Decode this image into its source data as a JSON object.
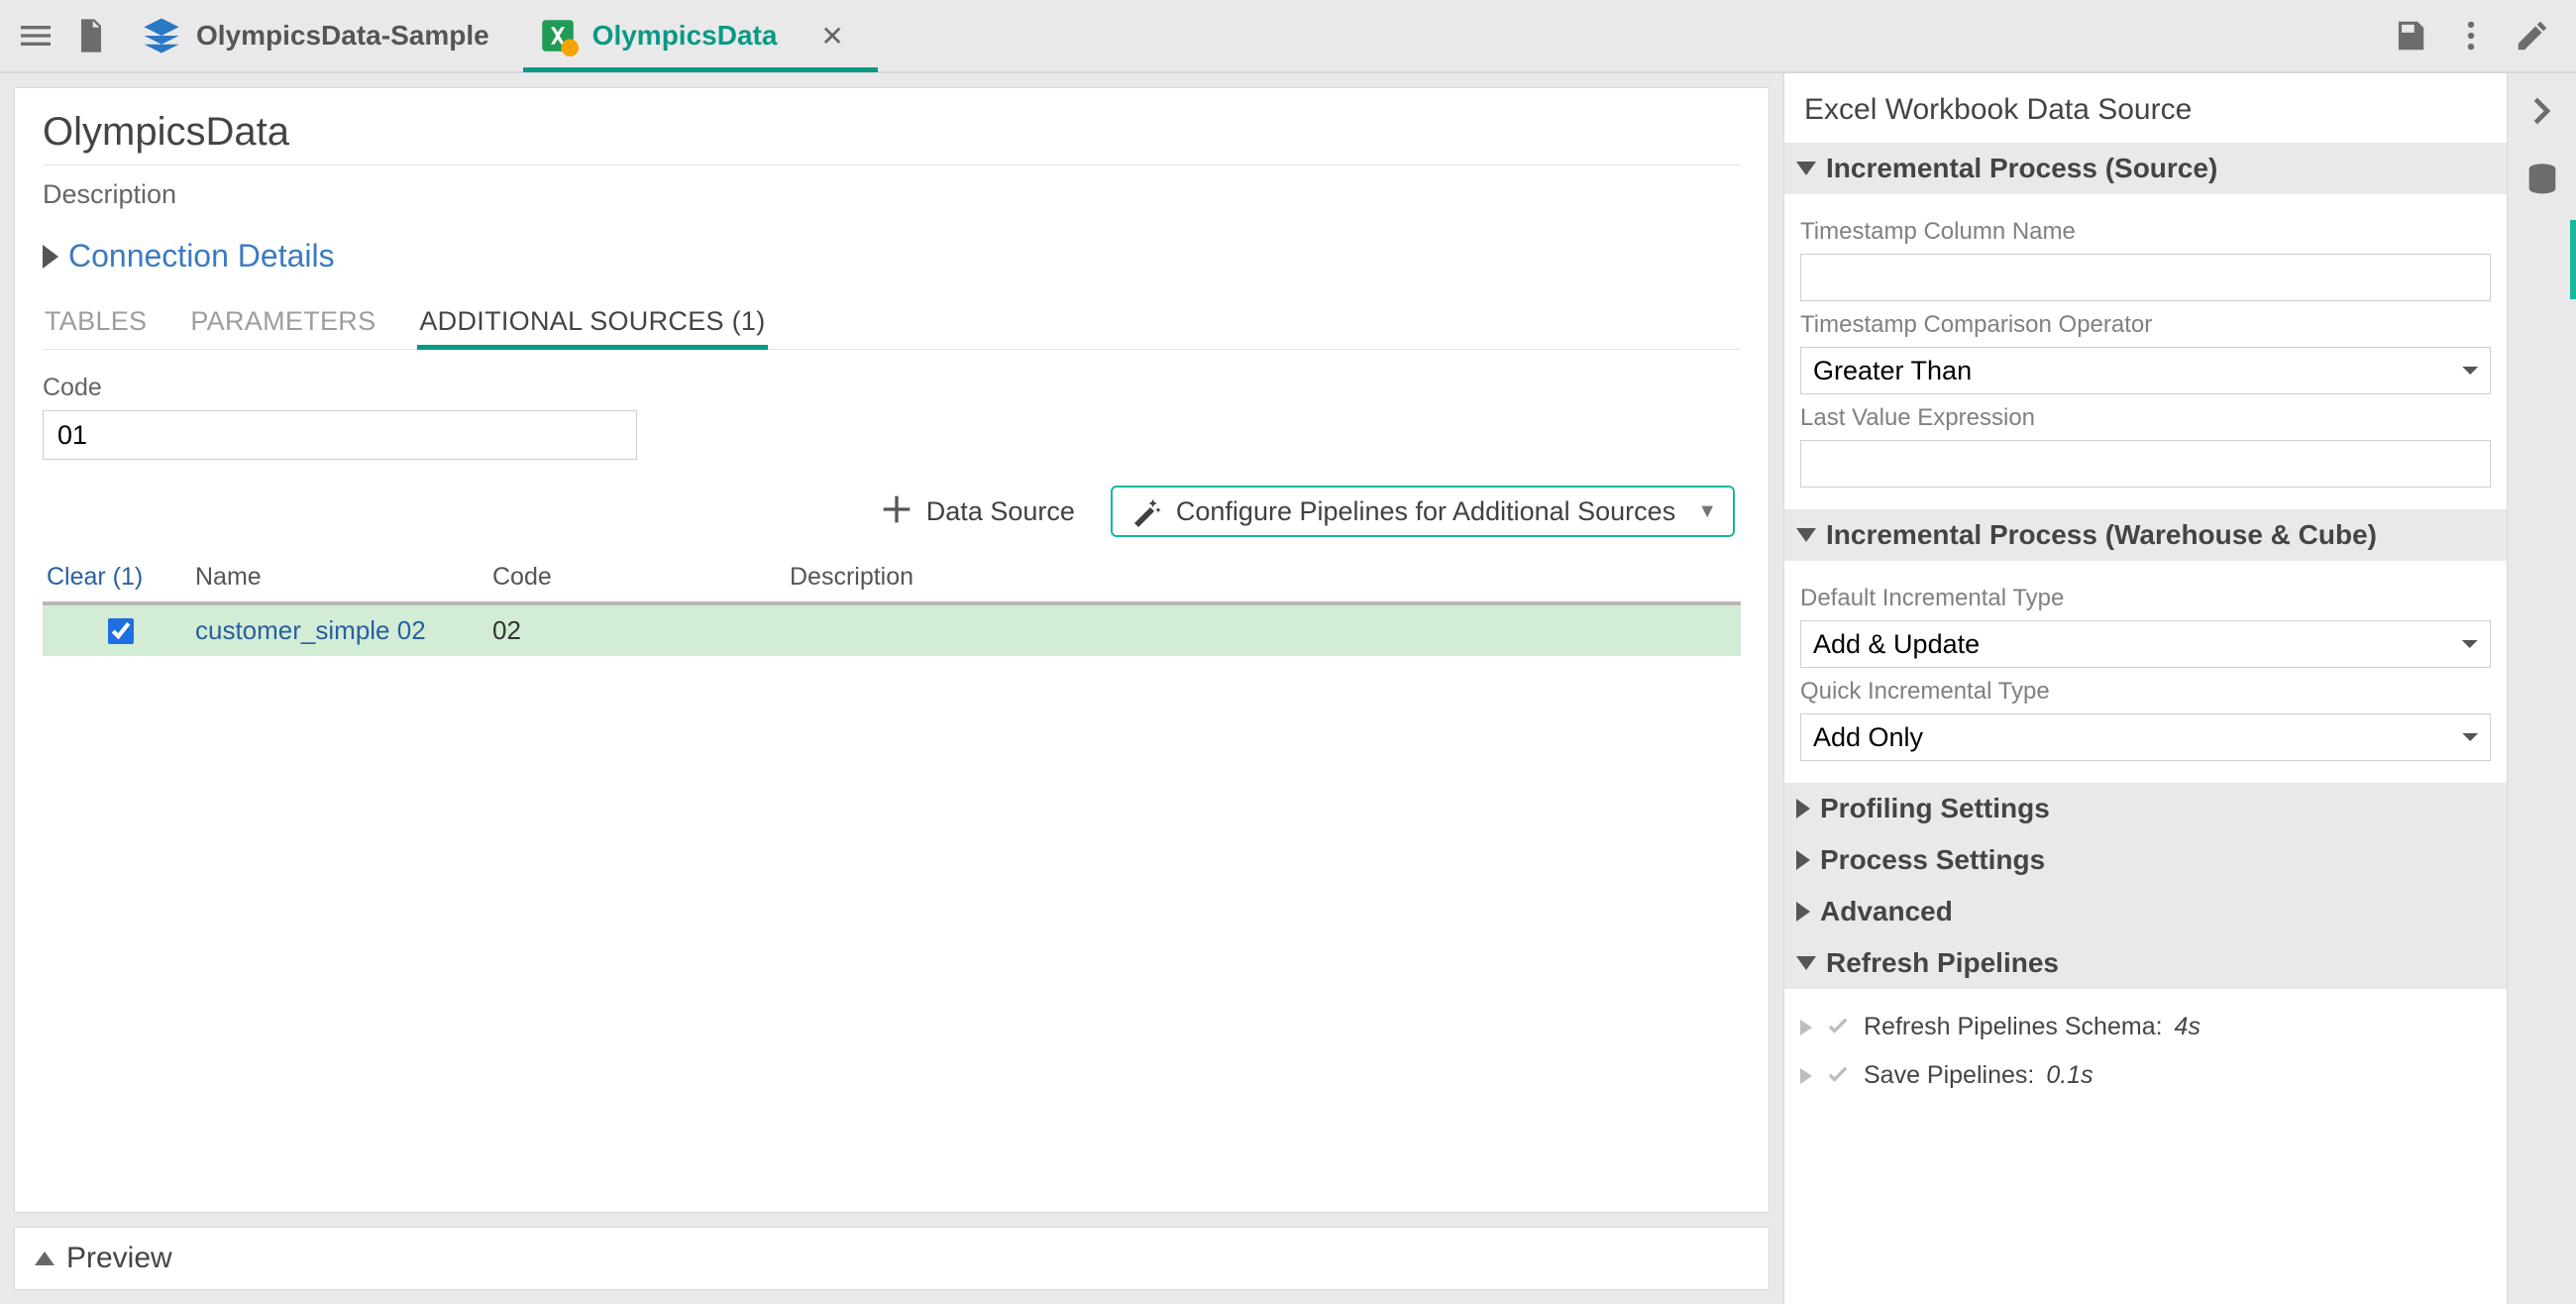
{
  "topbar": {
    "tabs": [
      {
        "label": "OlympicsData-Sample",
        "active": false
      },
      {
        "label": "OlympicsData",
        "active": true
      }
    ]
  },
  "main": {
    "title": "OlympicsData",
    "description_label": "Description",
    "connection_details_label": "Connection Details",
    "inner_tabs": {
      "tables": "TABLES",
      "parameters": "PARAMETERS",
      "additional_sources": "ADDITIONAL SOURCES (1)"
    },
    "code_label": "Code",
    "code_value": "01",
    "actions": {
      "data_source": "Data Source",
      "configure_pipelines": "Configure Pipelines for Additional Sources"
    },
    "table": {
      "clear_label": "Clear (1)",
      "headers": {
        "name": "Name",
        "code": "Code",
        "description": "Description"
      },
      "rows": [
        {
          "checked": true,
          "name": "customer_simple 02",
          "code": "02",
          "description": ""
        }
      ]
    }
  },
  "preview": {
    "label": "Preview"
  },
  "side": {
    "title": "Excel Workbook Data Source",
    "incr_source": {
      "header": "Incremental Process (Source)",
      "ts_col_label": "Timestamp Column Name",
      "ts_col_value": "",
      "ts_op_label": "Timestamp Comparison Operator",
      "ts_op_value": "Greater Than",
      "last_val_label": "Last Value Expression",
      "last_val_value": ""
    },
    "incr_wc": {
      "header": "Incremental Process (Warehouse & Cube)",
      "default_label": "Default Incremental Type",
      "default_value": "Add & Update",
      "quick_label": "Quick Incremental Type",
      "quick_value": "Add Only"
    },
    "profiling": "Profiling Settings",
    "process": "Process Settings",
    "advanced": "Advanced",
    "refresh": {
      "header": "Refresh Pipelines",
      "item1_label": "Refresh Pipelines Schema:",
      "item1_time": "4s",
      "item2_label": "Save Pipelines:",
      "item2_time": "0.1s"
    }
  }
}
